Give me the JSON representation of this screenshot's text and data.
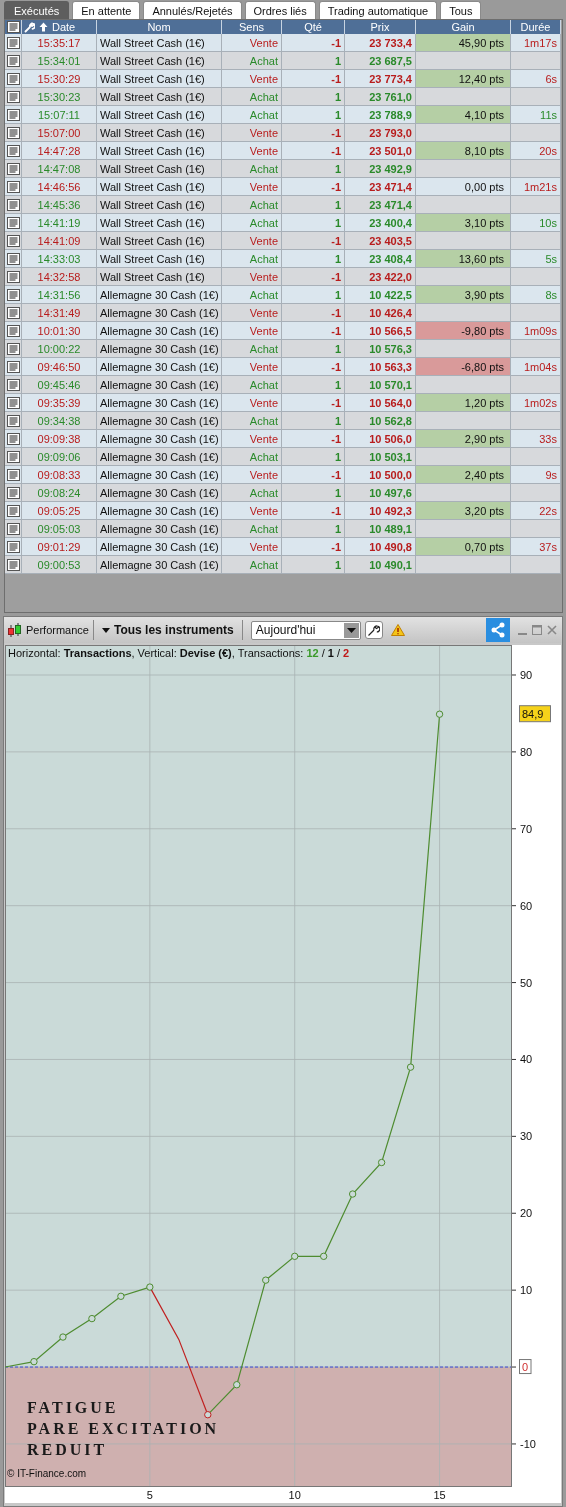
{
  "tabs": [
    {
      "label": "Exécutés",
      "selected": true
    },
    {
      "label": "En attente",
      "selected": false
    },
    {
      "label": "Annulés/Rejetés",
      "selected": false
    },
    {
      "label": "Ordres liés",
      "selected": false
    },
    {
      "label": "Trading automatique",
      "selected": false
    },
    {
      "label": "Tous",
      "selected": false
    }
  ],
  "table": {
    "columns": [
      {
        "label": "Date",
        "sorted": true
      },
      {
        "label": "Nom",
        "sorted": false
      },
      {
        "label": "Sens",
        "sorted": false
      },
      {
        "label": "Qté",
        "sorted": false
      },
      {
        "label": "Prix",
        "sorted": false
      },
      {
        "label": "Gain",
        "sorted": false
      },
      {
        "label": "Durée",
        "sorted": false
      }
    ],
    "rows": [
      {
        "date": "15:35:17",
        "nom": "Wall Street Cash (1€)",
        "sens": "Vente",
        "kind": "sell",
        "qte": "-1",
        "prix": "23 733,4",
        "gain": {
          "text": "45,90 pts",
          "color": "#b5cfa5"
        },
        "duree": "1m17s"
      },
      {
        "date": "15:34:01",
        "nom": "Wall Street Cash (1€)",
        "sens": "Achat",
        "kind": "buy",
        "qte": "1",
        "prix": "23 687,5"
      },
      {
        "date": "15:30:29",
        "nom": "Wall Street Cash (1€)",
        "sens": "Vente",
        "kind": "sell",
        "qte": "-1",
        "prix": "23 773,4",
        "gain": {
          "text": "12,40 pts",
          "color": "#b5cfa5"
        },
        "duree": "6s"
      },
      {
        "date": "15:30:23",
        "nom": "Wall Street Cash (1€)",
        "sens": "Achat",
        "kind": "buy",
        "qte": "1",
        "prix": "23 761,0"
      },
      {
        "date": "15:07:11",
        "nom": "Wall Street Cash (1€)",
        "sens": "Achat",
        "kind": "buy",
        "qte": "1",
        "prix": "23 788,9",
        "gain": {
          "text": "4,10 pts",
          "color": "#b5cfa5"
        },
        "duree": "11s"
      },
      {
        "date": "15:07:00",
        "nom": "Wall Street Cash (1€)",
        "sens": "Vente",
        "kind": "sell",
        "qte": "-1",
        "prix": "23 793,0"
      },
      {
        "date": "14:47:28",
        "nom": "Wall Street Cash (1€)",
        "sens": "Vente",
        "kind": "sell",
        "qte": "-1",
        "prix": "23 501,0",
        "gain": {
          "text": "8,10 pts",
          "color": "#b5cfa5"
        },
        "duree": "20s"
      },
      {
        "date": "14:47:08",
        "nom": "Wall Street Cash (1€)",
        "sens": "Achat",
        "kind": "buy",
        "qte": "1",
        "prix": "23 492,9"
      },
      {
        "date": "14:46:56",
        "nom": "Wall Street Cash (1€)",
        "sens": "Vente",
        "kind": "sell",
        "qte": "-1",
        "prix": "23 471,4",
        "gain": {
          "text": "0,00 pts",
          "color": "#dbe6ee"
        },
        "duree": "1m21s"
      },
      {
        "date": "14:45:36",
        "nom": "Wall Street Cash (1€)",
        "sens": "Achat",
        "kind": "buy",
        "qte": "1",
        "prix": "23 471,4"
      },
      {
        "date": "14:41:19",
        "nom": "Wall Street Cash (1€)",
        "sens": "Achat",
        "kind": "buy",
        "qte": "1",
        "prix": "23 400,4",
        "gain": {
          "text": "3,10 pts",
          "color": "#b5cfa5"
        },
        "duree": "10s"
      },
      {
        "date": "14:41:09",
        "nom": "Wall Street Cash (1€)",
        "sens": "Vente",
        "kind": "sell",
        "qte": "-1",
        "prix": "23 403,5"
      },
      {
        "date": "14:33:03",
        "nom": "Wall Street Cash (1€)",
        "sens": "Achat",
        "kind": "buy",
        "qte": "1",
        "prix": "23 408,4",
        "gain": {
          "text": "13,60 pts",
          "color": "#b5cfa5"
        },
        "duree": "5s"
      },
      {
        "date": "14:32:58",
        "nom": "Wall Street Cash (1€)",
        "sens": "Vente",
        "kind": "sell",
        "qte": "-1",
        "prix": "23 422,0"
      },
      {
        "date": "14:31:56",
        "nom": "Allemagne 30 Cash (1€)",
        "sens": "Achat",
        "kind": "buy",
        "qte": "1",
        "prix": "10 422,5",
        "gain": {
          "text": "3,90 pts",
          "color": "#b5cfa5"
        },
        "duree": "8s"
      },
      {
        "date": "14:31:49",
        "nom": "Allemagne 30 Cash (1€)",
        "sens": "Vente",
        "kind": "sell",
        "qte": "-1",
        "prix": "10 426,4"
      },
      {
        "date": "10:01:30",
        "nom": "Allemagne 30 Cash (1€)",
        "sens": "Vente",
        "kind": "sell",
        "qte": "-1",
        "prix": "10 566,5",
        "gain": {
          "text": "-9,80 pts",
          "color": "#d99a9a"
        },
        "duree": "1m09s"
      },
      {
        "date": "10:00:22",
        "nom": "Allemagne 30 Cash (1€)",
        "sens": "Achat",
        "kind": "buy",
        "qte": "1",
        "prix": "10 576,3"
      },
      {
        "date": "09:46:50",
        "nom": "Allemagne 30 Cash (1€)",
        "sens": "Vente",
        "kind": "sell",
        "qte": "-1",
        "prix": "10 563,3",
        "gain": {
          "text": "-6,80 pts",
          "color": "#d99a9a"
        },
        "duree": "1m04s"
      },
      {
        "date": "09:45:46",
        "nom": "Allemagne 30 Cash (1€)",
        "sens": "Achat",
        "kind": "buy",
        "qte": "1",
        "prix": "10 570,1"
      },
      {
        "date": "09:35:39",
        "nom": "Allemagne 30 Cash (1€)",
        "sens": "Vente",
        "kind": "sell",
        "qte": "-1",
        "prix": "10 564,0",
        "gain": {
          "text": "1,20 pts",
          "color": "#b5cfa5"
        },
        "duree": "1m02s"
      },
      {
        "date": "09:34:38",
        "nom": "Allemagne 30 Cash (1€)",
        "sens": "Achat",
        "kind": "buy",
        "qte": "1",
        "prix": "10 562,8"
      },
      {
        "date": "09:09:38",
        "nom": "Allemagne 30 Cash (1€)",
        "sens": "Vente",
        "kind": "sell",
        "qte": "-1",
        "prix": "10 506,0",
        "gain": {
          "text": "2,90 pts",
          "color": "#b5cfa5"
        },
        "duree": "33s"
      },
      {
        "date": "09:09:06",
        "nom": "Allemagne 30 Cash (1€)",
        "sens": "Achat",
        "kind": "buy",
        "qte": "1",
        "prix": "10 503,1"
      },
      {
        "date": "09:08:33",
        "nom": "Allemagne 30 Cash (1€)",
        "sens": "Vente",
        "kind": "sell",
        "qte": "-1",
        "prix": "10 500,0",
        "gain": {
          "text": "2,40 pts",
          "color": "#b5cfa5"
        },
        "duree": "9s"
      },
      {
        "date": "09:08:24",
        "nom": "Allemagne 30 Cash (1€)",
        "sens": "Achat",
        "kind": "buy",
        "qte": "1",
        "prix": "10 497,6"
      },
      {
        "date": "09:05:25",
        "nom": "Allemagne 30 Cash (1€)",
        "sens": "Vente",
        "kind": "sell",
        "qte": "-1",
        "prix": "10 492,3",
        "gain": {
          "text": "3,20 pts",
          "color": "#b5cfa5"
        },
        "duree": "22s"
      },
      {
        "date": "09:05:03",
        "nom": "Allemagne 30 Cash (1€)",
        "sens": "Achat",
        "kind": "buy",
        "qte": "1",
        "prix": "10 489,1"
      },
      {
        "date": "09:01:29",
        "nom": "Allemagne 30 Cash (1€)",
        "sens": "Vente",
        "kind": "sell",
        "qte": "-1",
        "prix": "10 490,8",
        "gain": {
          "text": "0,70 pts",
          "color": "#b5cfa5"
        },
        "duree": "37s"
      },
      {
        "date": "09:00:53",
        "nom": "Allemagne 30 Cash (1€)",
        "sens": "Achat",
        "kind": "buy",
        "qte": "1",
        "prix": "10 490,1"
      }
    ]
  },
  "chart_panel": {
    "title": "Performance",
    "instrument_menu": "Tous les instruments",
    "period": {
      "value": "Aujourd'hui"
    },
    "info": "Horizontal: **Transactions**, Vertical: **Devise (€)**, Transactions:",
    "transaction_counts": [
      {
        "text": "12",
        "color": "#3a9a2a"
      },
      {
        "text": "1",
        "color": "#111111"
      },
      {
        "text": "2",
        "color": "#c01818"
      }
    ],
    "count_separator": "/",
    "overlay_lines": [
      "FATIGUE",
      "PARE EXCITATION",
      "REDUIT"
    ],
    "copyright": "© IT-Finance.com",
    "chart_data": {
      "type": "line",
      "x": [
        0,
        1,
        2,
        3,
        4,
        5,
        6,
        7,
        8,
        9,
        10,
        11,
        12,
        13,
        14,
        15
      ],
      "series": [
        {
          "color": "#4e8c30",
          "marker": "circle",
          "values": [
            0,
            0.7,
            3.9,
            6.3,
            9.2,
            10.4,
            null,
            -6.2,
            -2.3,
            11.3,
            14.4,
            14.4,
            22.5,
            26.6,
            39.0,
            84.9
          ]
        },
        {
          "color": "#c02020",
          "values": [
            null,
            null,
            null,
            null,
            null,
            10.4,
            3.6,
            -6.2,
            null,
            null,
            null,
            null,
            null,
            null,
            null,
            null
          ]
        }
      ],
      "xlim": [
        0,
        17.5
      ],
      "ylim": [
        -15.6,
        93.9
      ],
      "xticks": [
        5,
        10,
        15
      ],
      "yticks": [
        -10,
        0,
        10,
        20,
        30,
        40,
        50,
        60,
        70,
        80,
        90
      ],
      "grid": true,
      "bands": [
        {
          "axis": "y",
          "from": 0,
          "to": 93.9,
          "color": "#cadad8"
        },
        {
          "axis": "y",
          "from": -15.6,
          "to": 0,
          "color": "#cfb0af"
        }
      ],
      "ref_lines": [
        {
          "axis": "y",
          "value": 0,
          "color": "#3a4ad8",
          "label": "0"
        }
      ],
      "annotations": [
        "84,9"
      ]
    }
  }
}
